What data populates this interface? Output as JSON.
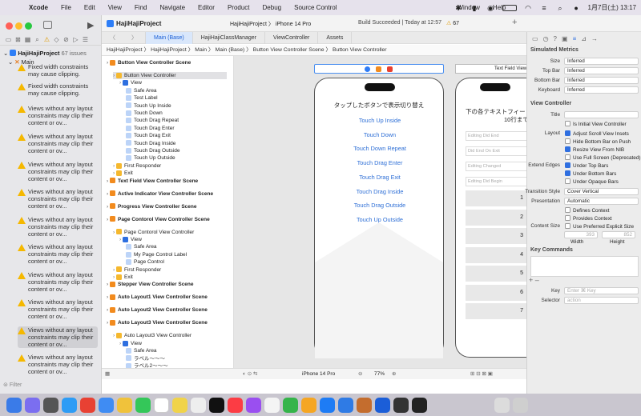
{
  "menubar": {
    "app": "Xcode",
    "items": [
      "File",
      "Edit",
      "View",
      "Find",
      "Navigate",
      "Editor",
      "Product",
      "Debug",
      "Source Control",
      "Window",
      "Help"
    ],
    "clock": "1月7日(土) 13:17"
  },
  "toolbar": {
    "project": "HajiHajiProject",
    "issues_count": "67 issues",
    "scheme": "HajiHajiProject",
    "device": "iPhone 14 Pro",
    "build_status": "Build Succeeded",
    "build_time": "| Today at 12:57",
    "warnings": "67"
  },
  "navigator": {
    "root": "HajiHajiProject",
    "group": "Main",
    "issues": [
      "Fixed width constraints may cause clipping.",
      "Fixed width constraints may cause clipping.",
      "Views without any layout constraints may clip their content or ov...",
      "Views without any layout constraints may clip their content or ov...",
      "Views without any layout constraints may clip their content or ov...",
      "Views without any layout constraints may clip their content or ov...",
      "Views without any layout constraints may clip their content or ov...",
      "Views without any layout constraints may clip their content or ov...",
      "Views without any layout constraints may clip their content or ov...",
      "Views without any layout constraints may clip their content or ov...",
      "Views without any layout constraints may clip their content or ov...",
      "Views without any layout constraints may clip their content or ov...",
      "Views without any layout constraints may clip their content or ov..."
    ],
    "filter_placeholder": "Filter"
  },
  "tabs": [
    "Main (Base)",
    "HajiHajiClassManager",
    "ViewController",
    "Assets"
  ],
  "jumpbar": "HajiHajiProject  〉 HajiHajiProject 〉 Main 〉 Main (Base) 〉 Button View Controller Scene 〉 Button View Controller",
  "outline": [
    {
      "t": "Button View Controller Scene",
      "l": 0,
      "s": true
    },
    {
      "t": "Button View Controller",
      "l": 1,
      "hl": true
    },
    {
      "t": "View",
      "l": 2
    },
    {
      "t": "Safe Area",
      "l": 3
    },
    {
      "t": "Test Label",
      "l": 3
    },
    {
      "t": "Touch Up Inside",
      "l": 3
    },
    {
      "t": "Touch Down",
      "l": 3
    },
    {
      "t": "Touch Drag Repeat",
      "l": 3
    },
    {
      "t": "Touch Drag Enter",
      "l": 3
    },
    {
      "t": "Touch Drag Exit",
      "l": 3
    },
    {
      "t": "Touch Drag Inside",
      "l": 3
    },
    {
      "t": "Touch Drag Outside",
      "l": 3
    },
    {
      "t": "Touch Up Outside",
      "l": 3
    },
    {
      "t": "First Responder",
      "l": 1
    },
    {
      "t": "Exit",
      "l": 1
    },
    {
      "t": "Text Field View Controller Scene",
      "l": 0,
      "s": true
    },
    {
      "t": "Active Indicator View Controller Scene",
      "l": 0,
      "s": true
    },
    {
      "t": "Progress View Controller Scene",
      "l": 0,
      "s": true
    },
    {
      "t": "Page Contorol View Controller Scene",
      "l": 0,
      "s": true
    },
    {
      "t": "Page Contorol View Controller",
      "l": 1
    },
    {
      "t": "View",
      "l": 2
    },
    {
      "t": "Safe Area",
      "l": 3
    },
    {
      "t": "My Page Control Label",
      "l": 3
    },
    {
      "t": "Page Control",
      "l": 3
    },
    {
      "t": "First Responder",
      "l": 1
    },
    {
      "t": "Exit",
      "l": 1
    },
    {
      "t": "Stepper View Controller Scene",
      "l": 0,
      "s": true
    },
    {
      "t": "Auto Layout1 View Controller Scene",
      "l": 0,
      "s": true
    },
    {
      "t": "Auto Layout2 View Controller Scene",
      "l": 0,
      "s": true
    },
    {
      "t": "Auto Layout3 View Controller Scene",
      "l": 0,
      "s": true
    },
    {
      "t": "Auto Layout3 View Controller",
      "l": 1
    },
    {
      "t": "View",
      "l": 2
    },
    {
      "t": "Safe Area",
      "l": 3
    },
    {
      "t": "ラベル〜〜〜",
      "l": 3
    },
    {
      "t": "ラベル2〜〜〜",
      "l": 3
    }
  ],
  "canvas": {
    "scene_label": "Text Field View",
    "phone1_title": "タップしたボタンで表示切り替え",
    "buttons": [
      "Touch Up Inside",
      "Touch Down",
      "Touch Down Repeat",
      "Touch Drag Enter",
      "Touch Drag Exit",
      "Touch Drag Inside",
      "Touch Drag Outside",
      "Touch Up Outside"
    ],
    "phone2_title": "下の各テキストフィー",
    "phone2_sub": "10行まで",
    "phone2_fields": [
      "Editing Did End",
      "Did End On Exit",
      "Editing Changed",
      "Editing Did Begin"
    ],
    "phone2_nums": [
      "1",
      "2",
      "3",
      "4",
      "5",
      "6",
      "7"
    ],
    "status_device": "iPhone 14 Pro",
    "zoom": "77%"
  },
  "inspector": {
    "simulated": "Simulated Metrics",
    "size_l": "Size",
    "size_v": "Inferred",
    "topbar_l": "Top Bar",
    "topbar_v": "Inferred",
    "bottombar_l": "Bottom Bar",
    "bottombar_v": "Inferred",
    "keyboard_l": "Keyboard",
    "keyboard_v": "Inferred",
    "vc": "View Controller",
    "title_l": "Title",
    "initial": "Is Initial View Controller",
    "layout_l": "Layout",
    "adjust": "Adjust Scroll View Insets",
    "hide": "Hide Bottom Bar on Push",
    "resize": "Resize View From NIB",
    "fullscreen": "Use Full Screen (Deprecated)",
    "edges_l": "Extend Edges",
    "under_top": "Under Top Bars",
    "under_bottom": "Under Bottom Bars",
    "under_opaque": "Under Opaque Bars",
    "trans_l": "Transition Style",
    "trans_v": "Cover Vertical",
    "pres_l": "Presentation",
    "pres_v": "Automatic",
    "defines": "Defines Context",
    "provides": "Provides Context",
    "content_l": "Content Size",
    "explicit": "Use Preferred Explicit Size",
    "w_val": "393",
    "h_val": "852",
    "width_l": "Width",
    "height_l": "Height",
    "keycmds": "Key Commands",
    "key_l": "Key",
    "key_ph": "Enter ⌘ Key",
    "sel_l": "Selector",
    "sel_ph": "action"
  }
}
